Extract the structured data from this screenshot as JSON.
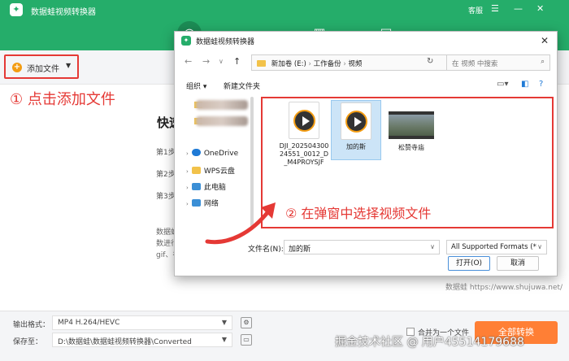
{
  "app": {
    "title": "数据蛙视频转换器",
    "window_controls": {
      "service": "客服",
      "menu": "☰",
      "minimize": "—",
      "close": "✕"
    }
  },
  "toolbar": {
    "add_file_label": "添加文件"
  },
  "annotations": {
    "step1": "① 点击添加文件",
    "step2": "② 在弹窗中选择视频文件"
  },
  "main": {
    "quick_title": "快速",
    "steps": [
      "第1步：",
      "第2步：",
      "第3步："
    ],
    "para": [
      "数据蛙",
      "数进行",
      "gif、视"
    ],
    "watermark": "数据蛙  https://www.shujuwa.net/"
  },
  "bottom": {
    "format_label": "输出格式：",
    "format_value": "MP4 H.264/HEVC",
    "save_label": "保存至：",
    "save_value": "D:\\数据蛙\\数据蛙视频转换器\\Converted",
    "merge_label": "合并为一个文件",
    "convert_label": "全部转换",
    "footer_watermark": "掘金技术社区 @ 用户45514179688"
  },
  "dialog": {
    "title": "数据蛙视频转换器",
    "path": [
      "新加卷 (E:)",
      "工作备份",
      "视频"
    ],
    "search_placeholder": "在 视频 中搜索",
    "organize": "组织",
    "new_folder": "新建文件夹",
    "nav": [
      {
        "label": "OneDrive",
        "color": "#1f7ad6"
      },
      {
        "label": "WPS云盘",
        "color": "#f2c24a"
      },
      {
        "label": "此电脑",
        "color": "#3b8fd6"
      },
      {
        "label": "网络",
        "color": "#3b8fd6"
      }
    ],
    "files": [
      {
        "name": "DJI_20250430024551_0012_D_M4PROYSJF",
        "kind": "video"
      },
      {
        "name": "加的斯",
        "kind": "video",
        "selected": true
      },
      {
        "name": "松赞寺庙",
        "kind": "thumbnail"
      }
    ],
    "filename_label": "文件名(N):",
    "filename_value": "加的斯",
    "filetype_value": "All Supported Formats (*",
    "open_label": "打开(O)",
    "cancel_label": "取消"
  },
  "colors": {
    "brand": "#25ad6a",
    "accent": "#ff7f35",
    "annotation": "#e53935"
  }
}
